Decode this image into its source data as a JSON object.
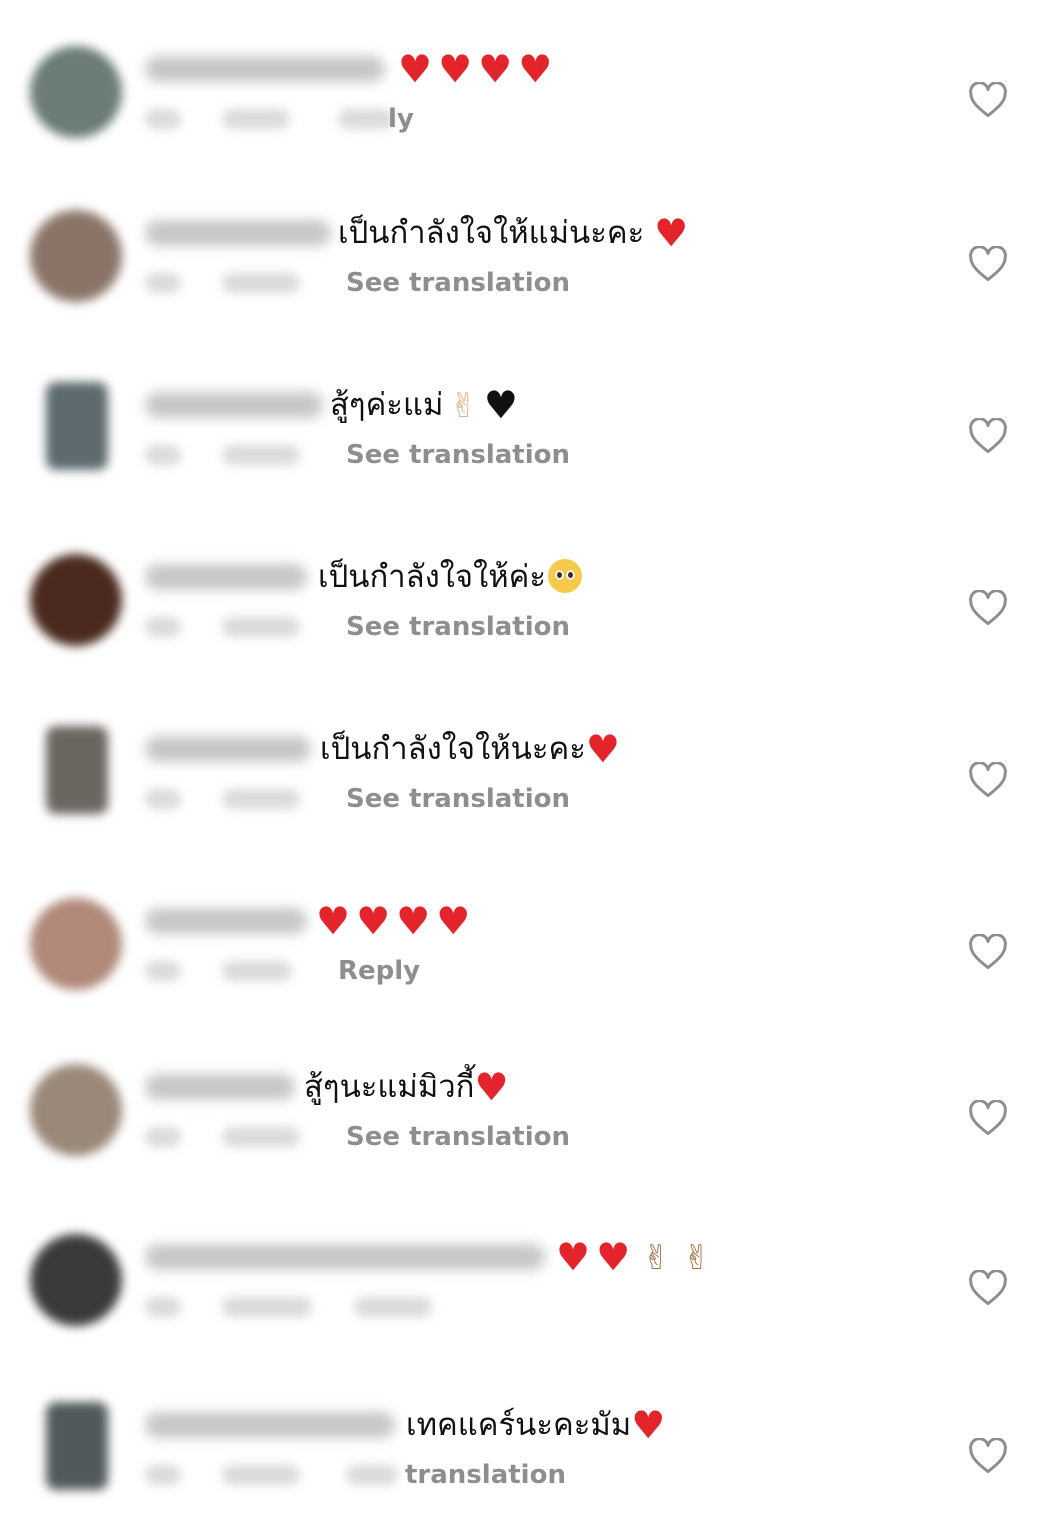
{
  "comments": [
    {
      "id": "c1",
      "text": "",
      "emojis": [
        "heart",
        "heart",
        "heart",
        "heart"
      ],
      "meta_visible": "ly",
      "avatar_color": "#6b7d74"
    },
    {
      "id": "c2",
      "text": "เป็นกำลังใจให้แม่นะคะ",
      "emojis": [
        "heart"
      ],
      "meta_visible": "See translation",
      "avatar_color": "#8a7468"
    },
    {
      "id": "c3",
      "text": "สู้ๆค่ะแม่",
      "emojis": [
        "peace-light",
        "black-heart"
      ],
      "meta_visible": "See translation",
      "avatar_color": "#5d6a6e"
    },
    {
      "id": "c4",
      "text": "เป็นกำลังใจให้ค่ะ",
      "emojis": [
        "pleading"
      ],
      "meta_visible": "See translation",
      "avatar_color": "#4a2a1e"
    },
    {
      "id": "c5",
      "text": "เป็นกำลังใจให้นะคะ",
      "emojis": [
        "heart"
      ],
      "meta_visible": "See translation",
      "avatar_color": "#6a6660"
    },
    {
      "id": "c6",
      "text": "",
      "emojis": [
        "heart",
        "heart",
        "heart",
        "heart"
      ],
      "meta_visible": "Reply",
      "avatar_color": "#b08978"
    },
    {
      "id": "c7",
      "text": "สู้ๆนะแม่มิวกี้",
      "emojis": [
        "heart"
      ],
      "meta_visible": "See translation",
      "avatar_color": "#9a8878"
    },
    {
      "id": "c8",
      "text": "",
      "emojis": [
        "heart",
        "heart",
        "peace-dark",
        "peace-dark"
      ],
      "meta_visible": "",
      "avatar_color": "#3c3a38"
    },
    {
      "id": "c9",
      "text": "เทคแคร์นะคะมัม",
      "emojis": [
        "heart"
      ],
      "meta_visible": "translation",
      "avatar_color": "#505a5a"
    }
  ],
  "icons": {
    "like": "heart-outline-icon"
  },
  "colors": {
    "heart": "#e3242b",
    "meta_text": "#8e8e8e",
    "like_outline": "#8e8e8e"
  }
}
